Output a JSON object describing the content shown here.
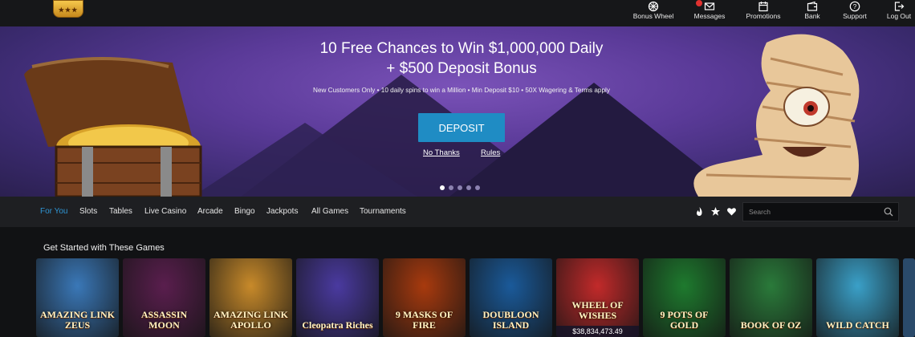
{
  "topnav": {
    "items": [
      {
        "label": "Bonus Wheel"
      },
      {
        "label": "Messages"
      },
      {
        "label": "Promotions"
      },
      {
        "label": "Bank"
      },
      {
        "label": "Support"
      },
      {
        "label": "Log Out"
      }
    ]
  },
  "hero": {
    "headline_1": "10 Free Chances to Win $1,000,000 Daily",
    "headline_2": "+ $500 Deposit Bonus",
    "terms": "New Customers Only • 10 daily spins to win a Million • Min Deposit $10 • 50X Wagering & Terms apply",
    "deposit_label": "DEPOSIT",
    "no_thanks_label": "No Thanks",
    "rules_label": "Rules",
    "slides": 5,
    "active_slide": 1
  },
  "categories": {
    "tabs": [
      "For You",
      "Slots",
      "Tables",
      "Live Casino",
      "Arcade",
      "Bingo",
      "Jackpots",
      "All Games",
      "Tournaments"
    ],
    "active": "For You",
    "search_placeholder": "Search"
  },
  "games": {
    "title": "Get Started with These Games",
    "tiles": [
      {
        "name": "AMAZING LINK ZEUS",
        "bg": "#3a78b8"
      },
      {
        "name": "ASSASSIN MOON",
        "bg": "#5a1e4e"
      },
      {
        "name": "AMAZING LINK APOLLO",
        "bg": "#c88a2a"
      },
      {
        "name": "Cleopatra Riches",
        "bg": "#4a3aa0"
      },
      {
        "name": "9 MASKS OF FIRE",
        "bg": "#a83a0e"
      },
      {
        "name": "DOUBLOON ISLAND",
        "bg": "#1a5a9a"
      },
      {
        "name": "WHEEL OF WISHES",
        "bg": "#c22a2a",
        "jackpot": "$38,834,473.49"
      },
      {
        "name": "9 POTS OF GOLD",
        "bg": "#1e7a2e"
      },
      {
        "name": "BOOK OF OZ",
        "bg": "#2a7a3a"
      },
      {
        "name": "WILD CATCH",
        "bg": "#3aa0c8"
      }
    ]
  },
  "colors": {
    "accent": "#1f8cc4",
    "active_tab": "#2f95d4",
    "badge": "#e0312f"
  }
}
